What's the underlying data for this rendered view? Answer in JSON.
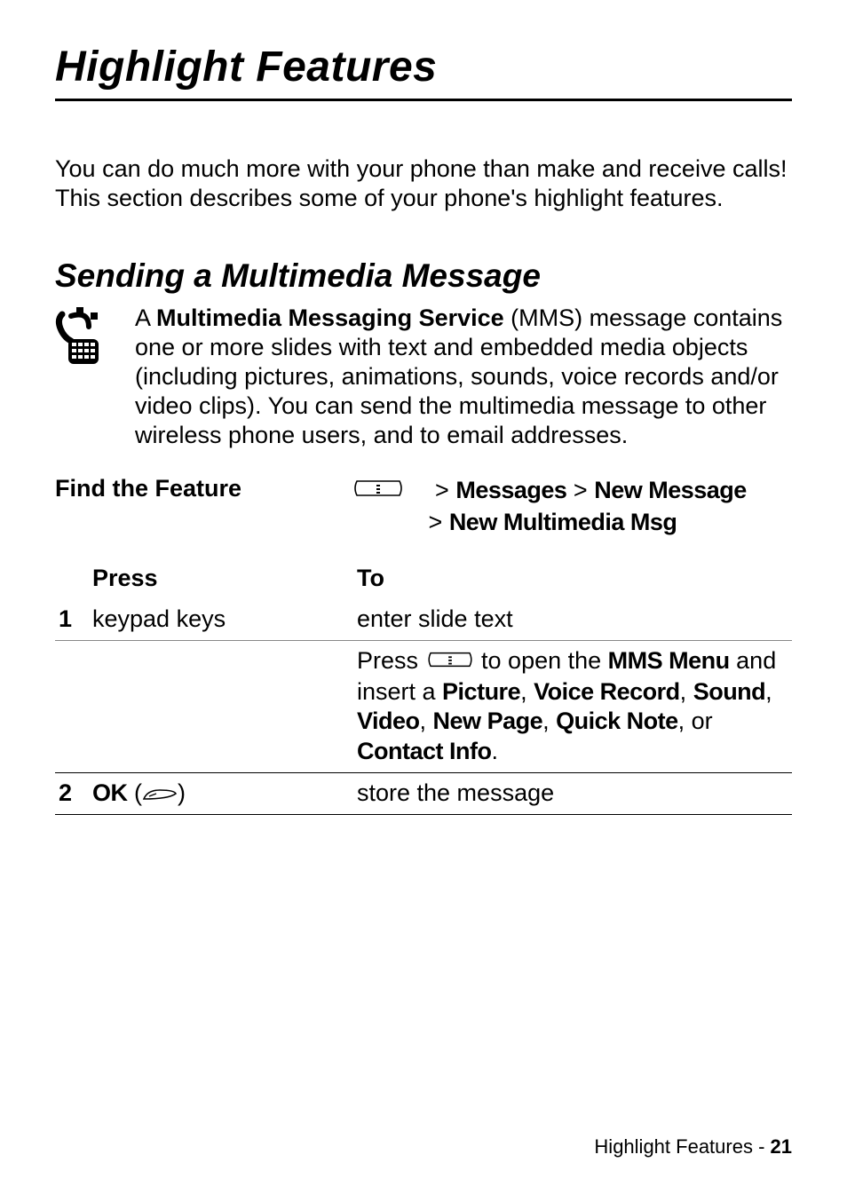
{
  "page_title": "Highlight Features",
  "intro": "You can do much more with your phone than make and receive calls! This section describes some of your phone's highlight features.",
  "section_title": "Sending a Multimedia Message",
  "description": {
    "prefix": "A ",
    "bold": "Multimedia Messaging Service",
    "suffix": " (MMS) message contains one or more slides with text and embedded media objects (including pictures, animations, sounds, voice records and/or video clips). You can send the multimedia message to other wireless phone users, and to email addresses."
  },
  "find_feature": {
    "label": "Find the Feature",
    "gt1": "> ",
    "messages": "Messages",
    "gt2": " > ",
    "new_message": "New Message",
    "gt3": "> ",
    "new_mms": "New Multimedia Msg"
  },
  "table": {
    "press_hdr": "Press",
    "to_hdr": "To",
    "row1": {
      "num": "1",
      "press": "keypad keys",
      "to": "enter slide text"
    },
    "note": {
      "prefix": "Press ",
      "mid": " to open the ",
      "mms_menu": "MMS Menu",
      "and_insert": " and insert a ",
      "picture": "Picture",
      "c1": ", ",
      "voice": "Voice Record",
      "c2": ", ",
      "sound": "Sound",
      "c3": ", ",
      "video": "Video",
      "c4": ", ",
      "newpage": "New Page",
      "c5": ", ",
      "quicknote": "Quick Note",
      "or": ", or ",
      "contact": "Contact Info",
      "period": "."
    },
    "row2": {
      "num": "2",
      "ok": "OK",
      "to": "store the message"
    }
  },
  "footer": {
    "section": "Highlight Features - ",
    "page": "21"
  }
}
